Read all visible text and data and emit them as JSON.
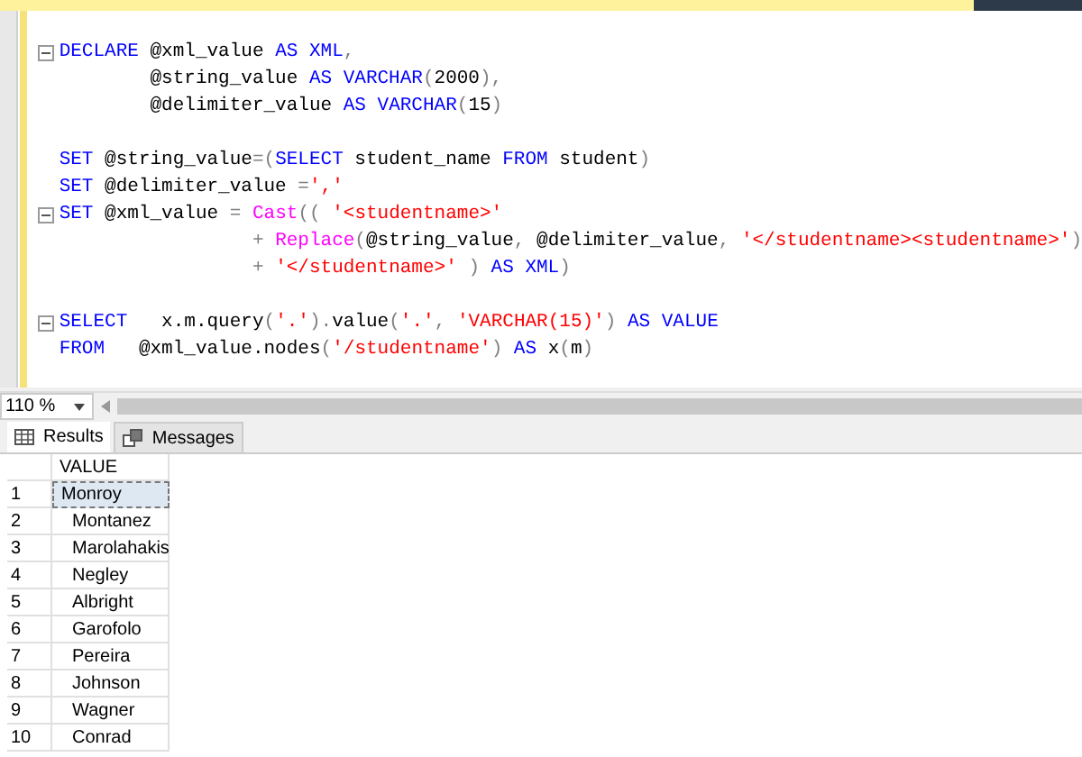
{
  "code_lines": [
    {
      "kind": "code",
      "fold": true,
      "segments": [
        {
          "t": "DECLARE",
          "kind": "kw"
        },
        {
          "t": " @xml_value ",
          "kind": "plain"
        },
        {
          "t": "AS XML",
          "kind": "kw"
        },
        {
          "t": ",",
          "kind": "op"
        }
      ]
    },
    {
      "kind": "code",
      "fold": false,
      "segments": [
        {
          "t": "        @string_value ",
          "kind": "plain"
        },
        {
          "t": "AS VARCHAR",
          "kind": "kw"
        },
        {
          "t": "(",
          "kind": "op"
        },
        {
          "t": "2000",
          "kind": "plain"
        },
        {
          "t": "),",
          "kind": "op"
        }
      ]
    },
    {
      "kind": "code",
      "fold": false,
      "segments": [
        {
          "t": "        @delimiter_value ",
          "kind": "plain"
        },
        {
          "t": "AS VARCHAR",
          "kind": "kw"
        },
        {
          "t": "(",
          "kind": "op"
        },
        {
          "t": "15",
          "kind": "plain"
        },
        {
          "t": ")",
          "kind": "op"
        }
      ]
    },
    {
      "kind": "blank"
    },
    {
      "kind": "code",
      "fold": false,
      "segments": [
        {
          "t": "SET",
          "kind": "kw"
        },
        {
          "t": " @string_value",
          "kind": "plain"
        },
        {
          "t": "=(",
          "kind": "op"
        },
        {
          "t": "SELECT",
          "kind": "kw"
        },
        {
          "t": " student_name ",
          "kind": "plain"
        },
        {
          "t": "FROM",
          "kind": "kw"
        },
        {
          "t": " student",
          "kind": "plain"
        },
        {
          "t": ")",
          "kind": "op"
        }
      ]
    },
    {
      "kind": "code",
      "fold": false,
      "segments": [
        {
          "t": "SET",
          "kind": "kw"
        },
        {
          "t": " @delimiter_value ",
          "kind": "plain"
        },
        {
          "t": "=",
          "kind": "op"
        },
        {
          "t": "','",
          "kind": "str"
        }
      ]
    },
    {
      "kind": "code",
      "fold": true,
      "segments": [
        {
          "t": "SET",
          "kind": "kw"
        },
        {
          "t": " @xml_value ",
          "kind": "plain"
        },
        {
          "t": "= ",
          "kind": "op"
        },
        {
          "t": "Cast",
          "kind": "fn"
        },
        {
          "t": "(( ",
          "kind": "op"
        },
        {
          "t": "'<studentname>'",
          "kind": "str"
        }
      ]
    },
    {
      "kind": "code",
      "fold": false,
      "segments": [
        {
          "t": "                 + ",
          "kind": "op"
        },
        {
          "t": "Replace",
          "kind": "fn"
        },
        {
          "t": "(",
          "kind": "op"
        },
        {
          "t": "@string_value",
          "kind": "plain"
        },
        {
          "t": ", ",
          "kind": "op"
        },
        {
          "t": "@delimiter_value",
          "kind": "plain"
        },
        {
          "t": ", ",
          "kind": "op"
        },
        {
          "t": "'</studentname><studentname>'",
          "kind": "str"
        },
        {
          "t": ")",
          "kind": "op"
        }
      ]
    },
    {
      "kind": "code",
      "fold": false,
      "segments": [
        {
          "t": "                 + ",
          "kind": "op"
        },
        {
          "t": "'</studentname>'",
          "kind": "str"
        },
        {
          "t": " ) ",
          "kind": "op"
        },
        {
          "t": "AS XML",
          "kind": "kw"
        },
        {
          "t": ")",
          "kind": "op"
        }
      ]
    },
    {
      "kind": "blank"
    },
    {
      "kind": "code",
      "fold": true,
      "segments": [
        {
          "t": "SELECT",
          "kind": "kw"
        },
        {
          "t": "   x.m.query",
          "kind": "plain"
        },
        {
          "t": "(",
          "kind": "op"
        },
        {
          "t": "'.'",
          "kind": "str"
        },
        {
          "t": ").",
          "kind": "op"
        },
        {
          "t": "value",
          "kind": "plain"
        },
        {
          "t": "(",
          "kind": "op"
        },
        {
          "t": "'.'",
          "kind": "str"
        },
        {
          "t": ", ",
          "kind": "op"
        },
        {
          "t": "'VARCHAR(15)'",
          "kind": "str"
        },
        {
          "t": ") ",
          "kind": "op"
        },
        {
          "t": "AS VALUE",
          "kind": "kw"
        }
      ]
    },
    {
      "kind": "code",
      "fold": false,
      "segments": [
        {
          "t": "FROM",
          "kind": "kw"
        },
        {
          "t": "   @xml_value.nodes",
          "kind": "plain"
        },
        {
          "t": "(",
          "kind": "op"
        },
        {
          "t": "'/studentname'",
          "kind": "str"
        },
        {
          "t": ") ",
          "kind": "op"
        },
        {
          "t": "AS",
          "kind": "kw"
        },
        {
          "t": " x",
          "kind": "plain"
        },
        {
          "t": "(",
          "kind": "op"
        },
        {
          "t": "m",
          "kind": "plain"
        },
        {
          "t": ")",
          "kind": "op"
        }
      ]
    }
  ],
  "zoom": {
    "value": "110 %"
  },
  "tabs": [
    {
      "label": "Results",
      "selected": true
    },
    {
      "label": "Messages",
      "selected": false
    }
  ],
  "grid": {
    "columns": [
      "VALUE"
    ],
    "rows": [
      {
        "num": "1",
        "value": "Monroy",
        "selected": true
      },
      {
        "num": "2",
        "value": "Montanez",
        "selected": false
      },
      {
        "num": "3",
        "value": "Marolahakis",
        "selected": false
      },
      {
        "num": "4",
        "value": "Negley",
        "selected": false
      },
      {
        "num": "5",
        "value": "Albright",
        "selected": false
      },
      {
        "num": "6",
        "value": "Garofolo",
        "selected": false
      },
      {
        "num": "7",
        "value": "Pereira",
        "selected": false
      },
      {
        "num": "8",
        "value": "Johnson",
        "selected": false
      },
      {
        "num": "9",
        "value": "Wagner",
        "selected": false
      },
      {
        "num": "10",
        "value": "Conrad",
        "selected": false
      }
    ]
  }
}
